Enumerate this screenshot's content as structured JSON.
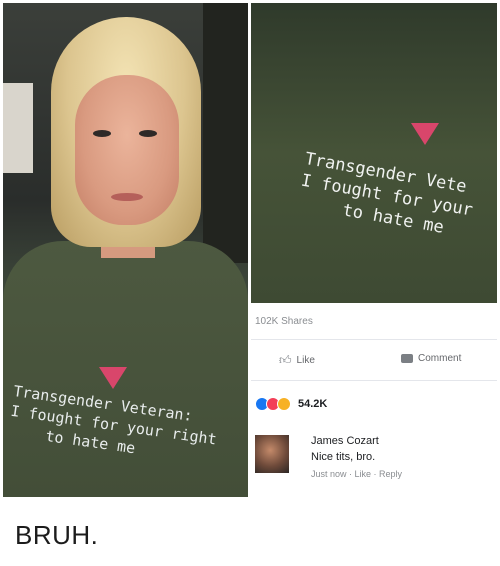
{
  "left_photo": {
    "shirt_lines": [
      "Transgender Veteran:",
      "I fought for your right",
      "to hate me"
    ]
  },
  "right_post": {
    "shirt_lines": [
      "Transgender Vete",
      "I fought for your",
      "to hate me"
    ],
    "shares": "102K Shares",
    "like_label": "Like",
    "comment_label": "Comment",
    "reaction_count": "54.2K",
    "comment": {
      "author": "James Cozart",
      "text": "Nice tits, bro.",
      "meta": "Just now · Like · Reply"
    }
  },
  "caption": "BRUH.",
  "colors": {
    "shirt_green": "#4d5940",
    "triangle_pink": "#d9466b",
    "like_blue": "#1877f2"
  }
}
